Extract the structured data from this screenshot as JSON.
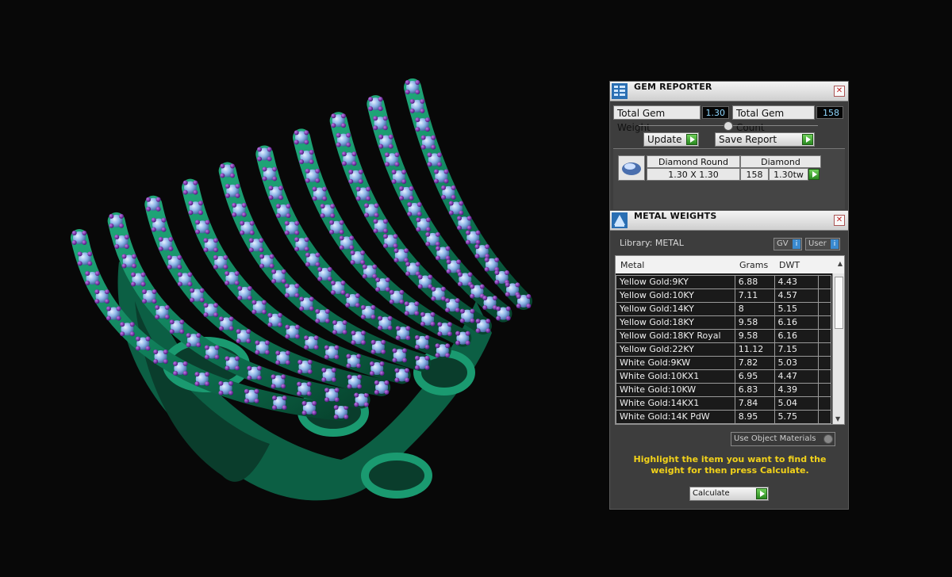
{
  "gem_reporter": {
    "title": "GEM REPORTER",
    "total_weight_label": "Total Gem Weight",
    "total_weight_value": "1.30",
    "total_count_label": "Total Gem Count",
    "total_count_value": "158",
    "update_label": "Update",
    "save_report_label": "Save Report",
    "gem": {
      "name": "Diamond Round",
      "size": "1.30 X 1.30",
      "material": "Diamond",
      "count": "158",
      "weight": "1.30tw"
    }
  },
  "metal_weights": {
    "title": "METAL WEIGHTS",
    "library_label": "Library: METAL",
    "gv_label": "GV",
    "user_label": "User",
    "columns": [
      "Metal",
      "Grams",
      "DWT"
    ],
    "rows": [
      {
        "metal": "Yellow Gold:9KY",
        "grams": "6.88",
        "dwt": "4.43"
      },
      {
        "metal": "Yellow Gold:10KY",
        "grams": "7.11",
        "dwt": "4.57"
      },
      {
        "metal": "Yellow Gold:14KY",
        "grams": "8",
        "dwt": "5.15"
      },
      {
        "metal": "Yellow Gold:18KY",
        "grams": "9.58",
        "dwt": "6.16"
      },
      {
        "metal": "Yellow Gold:18KY Royal",
        "grams": "9.58",
        "dwt": "6.16"
      },
      {
        "metal": "Yellow Gold:22KY",
        "grams": "11.12",
        "dwt": "7.15"
      },
      {
        "metal": "White Gold:9KW",
        "grams": "7.82",
        "dwt": "5.03"
      },
      {
        "metal": "White Gold:10KX1",
        "grams": "6.95",
        "dwt": "4.47"
      },
      {
        "metal": "White Gold:10KW",
        "grams": "6.83",
        "dwt": "4.39"
      },
      {
        "metal": "White Gold:14KX1",
        "grams": "7.84",
        "dwt": "5.04"
      },
      {
        "metal": "White Gold:14K PdW",
        "grams": "8.95",
        "dwt": "5.75"
      }
    ],
    "use_object_materials_label": "Use Object Materials",
    "hint": "Highlight the item you want to find the weight for then press Calculate.",
    "calculate_label": "Calculate"
  },
  "colors": {
    "metal_green": "#0f7a57",
    "gem_blue": "#8fb6e8",
    "accent_purple": "#6a1a9a",
    "hint_yellow": "#f2d21a"
  }
}
